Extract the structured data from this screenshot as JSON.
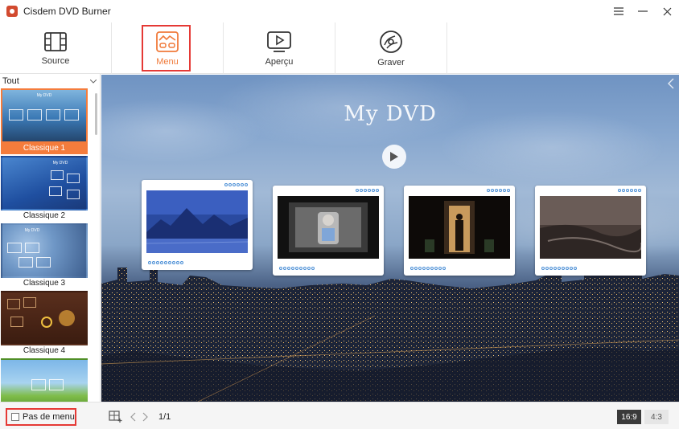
{
  "window": {
    "title": "Cisdem DVD Burner",
    "controls": [
      "menu-icon",
      "minimize-icon",
      "close-icon"
    ]
  },
  "toolbar": {
    "tabs": [
      {
        "label": "Source",
        "icon": "film-strip-icon",
        "active": false
      },
      {
        "label": "Menu",
        "icon": "menu-template-icon",
        "active": true
      },
      {
        "label": "Aperçu",
        "icon": "play-preview-icon",
        "active": false
      },
      {
        "label": "Graver",
        "icon": "disc-burn-icon",
        "active": false
      }
    ]
  },
  "sidebar": {
    "filter": {
      "value": "Tout"
    },
    "templates": [
      {
        "label": "Classique 1",
        "selected": true
      },
      {
        "label": "Classique 2",
        "selected": false
      },
      {
        "label": "Classique 3",
        "selected": false
      },
      {
        "label": "Classique 4",
        "selected": false
      },
      {
        "label": "",
        "selected": false
      }
    ]
  },
  "preview": {
    "title": "My DVD"
  },
  "bottom": {
    "no_menu_label": "Pas de menu",
    "page_indicator": "1/1",
    "aspect_ratios": [
      {
        "label": "16:9",
        "active": true
      },
      {
        "label": "4:3",
        "active": false
      }
    ]
  },
  "colors": {
    "accent": "#f47c3c",
    "highlight": "#e53935"
  }
}
